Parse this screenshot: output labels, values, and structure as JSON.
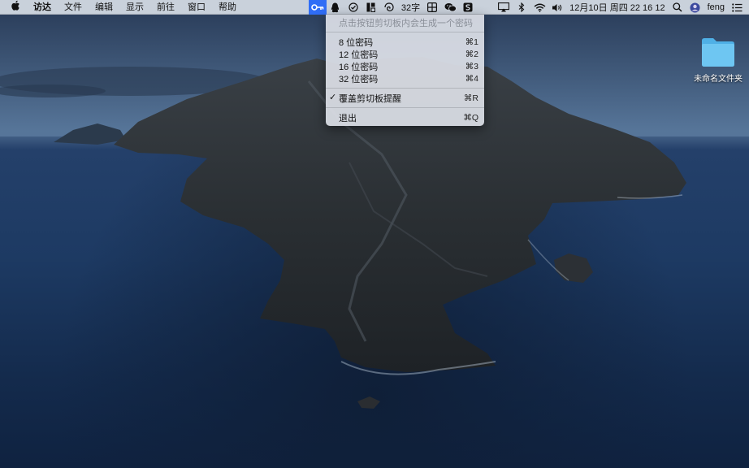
{
  "menubar": {
    "apple_icon": "apple-icon",
    "app_menus": [
      "访达",
      "文件",
      "编辑",
      "显示",
      "前往",
      "窗口",
      "帮助"
    ],
    "status": {
      "word_count": "32字",
      "datetime": "12月10日 周四  22 16 12",
      "username": "feng"
    }
  },
  "dropdown": {
    "hint": "点击按钮剪切板内会生成一个密码",
    "items": [
      {
        "label": "8 位密码",
        "shortcut": "⌘1"
      },
      {
        "label": "12 位密码",
        "shortcut": "⌘2"
      },
      {
        "label": "16 位密码",
        "shortcut": "⌘3"
      },
      {
        "label": "32 位密码",
        "shortcut": "⌘4"
      }
    ],
    "toggle": {
      "label": "覆盖剪切板提醒",
      "shortcut": "⌘R",
      "checked": true,
      "check_mark": "✓"
    },
    "quit": {
      "label": "退出",
      "shortcut": "⌘Q"
    }
  },
  "desktop": {
    "folder_label": "未命名文件夹",
    "colors": {
      "folder": "#6ec6f2",
      "menu_highlight": "#2f6df6"
    }
  }
}
